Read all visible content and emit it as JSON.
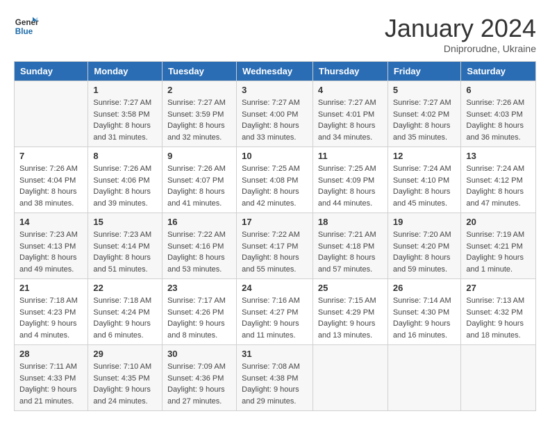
{
  "header": {
    "logo_general": "General",
    "logo_blue": "Blue",
    "month_year": "January 2024",
    "location": "Dniprorudne, Ukraine"
  },
  "days_of_week": [
    "Sunday",
    "Monday",
    "Tuesday",
    "Wednesday",
    "Thursday",
    "Friday",
    "Saturday"
  ],
  "weeks": [
    [
      {
        "day": "",
        "info": ""
      },
      {
        "day": "1",
        "info": "Sunrise: 7:27 AM\nSunset: 3:58 PM\nDaylight: 8 hours\nand 31 minutes."
      },
      {
        "day": "2",
        "info": "Sunrise: 7:27 AM\nSunset: 3:59 PM\nDaylight: 8 hours\nand 32 minutes."
      },
      {
        "day": "3",
        "info": "Sunrise: 7:27 AM\nSunset: 4:00 PM\nDaylight: 8 hours\nand 33 minutes."
      },
      {
        "day": "4",
        "info": "Sunrise: 7:27 AM\nSunset: 4:01 PM\nDaylight: 8 hours\nand 34 minutes."
      },
      {
        "day": "5",
        "info": "Sunrise: 7:27 AM\nSunset: 4:02 PM\nDaylight: 8 hours\nand 35 minutes."
      },
      {
        "day": "6",
        "info": "Sunrise: 7:26 AM\nSunset: 4:03 PM\nDaylight: 8 hours\nand 36 minutes."
      }
    ],
    [
      {
        "day": "7",
        "info": "Sunrise: 7:26 AM\nSunset: 4:04 PM\nDaylight: 8 hours\nand 38 minutes."
      },
      {
        "day": "8",
        "info": "Sunrise: 7:26 AM\nSunset: 4:06 PM\nDaylight: 8 hours\nand 39 minutes."
      },
      {
        "day": "9",
        "info": "Sunrise: 7:26 AM\nSunset: 4:07 PM\nDaylight: 8 hours\nand 41 minutes."
      },
      {
        "day": "10",
        "info": "Sunrise: 7:25 AM\nSunset: 4:08 PM\nDaylight: 8 hours\nand 42 minutes."
      },
      {
        "day": "11",
        "info": "Sunrise: 7:25 AM\nSunset: 4:09 PM\nDaylight: 8 hours\nand 44 minutes."
      },
      {
        "day": "12",
        "info": "Sunrise: 7:24 AM\nSunset: 4:10 PM\nDaylight: 8 hours\nand 45 minutes."
      },
      {
        "day": "13",
        "info": "Sunrise: 7:24 AM\nSunset: 4:12 PM\nDaylight: 8 hours\nand 47 minutes."
      }
    ],
    [
      {
        "day": "14",
        "info": "Sunrise: 7:23 AM\nSunset: 4:13 PM\nDaylight: 8 hours\nand 49 minutes."
      },
      {
        "day": "15",
        "info": "Sunrise: 7:23 AM\nSunset: 4:14 PM\nDaylight: 8 hours\nand 51 minutes."
      },
      {
        "day": "16",
        "info": "Sunrise: 7:22 AM\nSunset: 4:16 PM\nDaylight: 8 hours\nand 53 minutes."
      },
      {
        "day": "17",
        "info": "Sunrise: 7:22 AM\nSunset: 4:17 PM\nDaylight: 8 hours\nand 55 minutes."
      },
      {
        "day": "18",
        "info": "Sunrise: 7:21 AM\nSunset: 4:18 PM\nDaylight: 8 hours\nand 57 minutes."
      },
      {
        "day": "19",
        "info": "Sunrise: 7:20 AM\nSunset: 4:20 PM\nDaylight: 8 hours\nand 59 minutes."
      },
      {
        "day": "20",
        "info": "Sunrise: 7:19 AM\nSunset: 4:21 PM\nDaylight: 9 hours\nand 1 minute."
      }
    ],
    [
      {
        "day": "21",
        "info": "Sunrise: 7:18 AM\nSunset: 4:23 PM\nDaylight: 9 hours\nand 4 minutes."
      },
      {
        "day": "22",
        "info": "Sunrise: 7:18 AM\nSunset: 4:24 PM\nDaylight: 9 hours\nand 6 minutes."
      },
      {
        "day": "23",
        "info": "Sunrise: 7:17 AM\nSunset: 4:26 PM\nDaylight: 9 hours\nand 8 minutes."
      },
      {
        "day": "24",
        "info": "Sunrise: 7:16 AM\nSunset: 4:27 PM\nDaylight: 9 hours\nand 11 minutes."
      },
      {
        "day": "25",
        "info": "Sunrise: 7:15 AM\nSunset: 4:29 PM\nDaylight: 9 hours\nand 13 minutes."
      },
      {
        "day": "26",
        "info": "Sunrise: 7:14 AM\nSunset: 4:30 PM\nDaylight: 9 hours\nand 16 minutes."
      },
      {
        "day": "27",
        "info": "Sunrise: 7:13 AM\nSunset: 4:32 PM\nDaylight: 9 hours\nand 18 minutes."
      }
    ],
    [
      {
        "day": "28",
        "info": "Sunrise: 7:11 AM\nSunset: 4:33 PM\nDaylight: 9 hours\nand 21 minutes."
      },
      {
        "day": "29",
        "info": "Sunrise: 7:10 AM\nSunset: 4:35 PM\nDaylight: 9 hours\nand 24 minutes."
      },
      {
        "day": "30",
        "info": "Sunrise: 7:09 AM\nSunset: 4:36 PM\nDaylight: 9 hours\nand 27 minutes."
      },
      {
        "day": "31",
        "info": "Sunrise: 7:08 AM\nSunset: 4:38 PM\nDaylight: 9 hours\nand 29 minutes."
      },
      {
        "day": "",
        "info": ""
      },
      {
        "day": "",
        "info": ""
      },
      {
        "day": "",
        "info": ""
      }
    ]
  ]
}
